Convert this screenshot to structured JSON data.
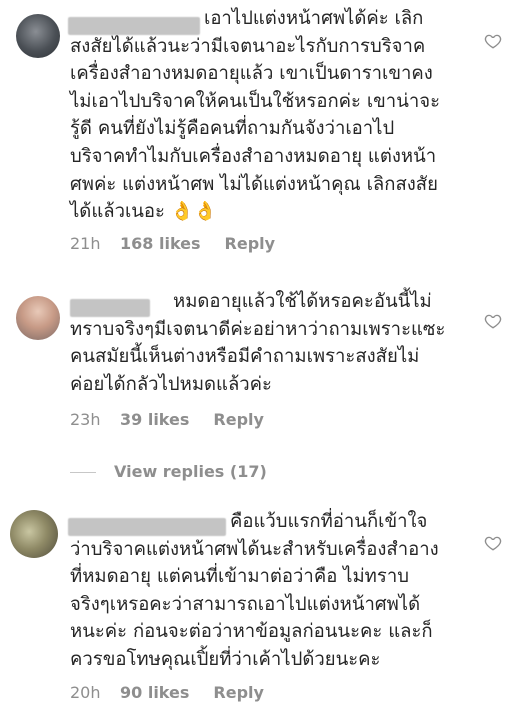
{
  "comments": [
    {
      "text": "เอาไปแต่งหน้าศพได้ค่ะ เลิก\nสงสัยได้แล้วนะว่ามีเจตนาอะไรกับการบริจาค\nเครื่องสำอางหมดอายุแล้ว เขาเป็นดาราเขาคง\nไม่เอาไปบริจาคให้คนเป็นใช้หรอกค่ะ เขาน่าจะ\nรู้ดี คนที่ยังไม่รู้คือคนที่ถามกันจังว่าเอาไป\nบริจาคทำไมกับเครื่องสำอางหมดอายุ แต่งหน้า\nศพค่ะ แต่งหน้าศพ ไม่ได้แต่งหน้าคุณ เลิกสงสัย\nได้แล้วเนอะ 👌👌",
      "time": "21h",
      "likes": "168 likes",
      "reply": "Reply",
      "like_icon": "heart-outline-icon"
    },
    {
      "text": "หมดอายุแล้วใช้ได้หรอคะอันนี้ไม่\nทราบจริงๆมีเจตนาดีค่ะอย่าหาว่าถามเพราะแซะ\nคนสมัยนี้เห็นต่างหรือมีคำถามเพราะสงสัยไม่\nค่อยได้กลัวไปหมดแล้วค่ะ",
      "time": "23h",
      "likes": "39 likes",
      "reply": "Reply",
      "like_icon": "heart-outline-icon"
    },
    {
      "text": "คือแว้บแรกที่อ่านก็เข้าใจ\nว่าบริจาคแต่งหน้าศพได้นะสำหรับเครื่องสำอาง\nที่หมดอายุ แต่คนที่เข้ามาต่อว่าคือ ไม่ทราบ\nจริงๆเหรอคะว่าสามารถเอาไปแต่งหน้าศพได้\nหนะค่ะ ก่อนจะต่อว่าหาข้อมูลก่อนนะคะ และก็\nควรขอโทษคุณเปิ้ยที่ว่าเค้าไปด้วยนะคะ",
      "time": "20h",
      "likes": "90 likes",
      "reply": "Reply",
      "like_icon": "heart-outline-icon"
    }
  ],
  "view_replies": "View replies (17)",
  "colors": {
    "text": "#262626",
    "meta": "#8e8e8e",
    "background": "#ffffff"
  }
}
